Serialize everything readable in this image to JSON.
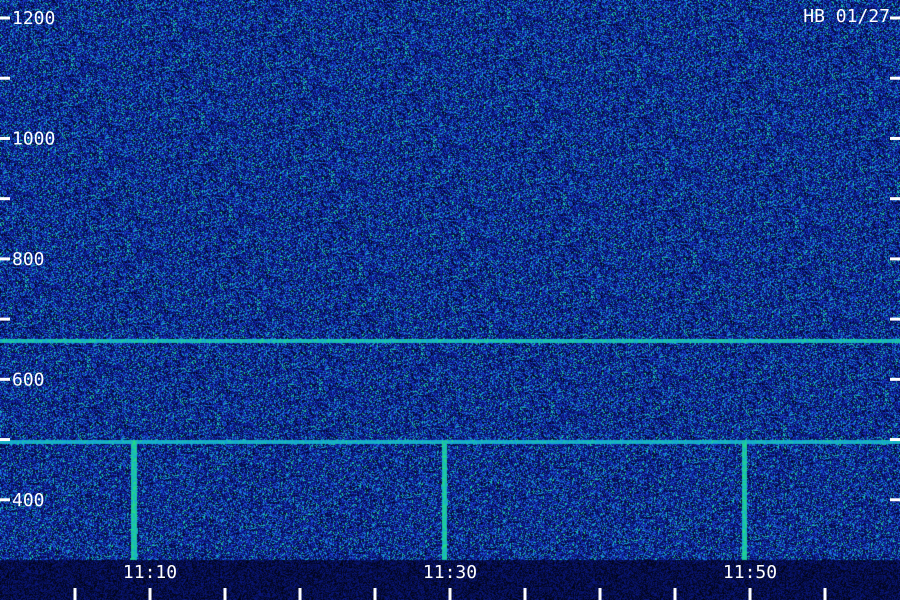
{
  "chart_data": {
    "type": "heatmap",
    "title": "HB 01/27",
    "xlabel": "",
    "ylabel": "",
    "x_ticks": [
      "11:10",
      "11:30",
      "11:50"
    ],
    "x_tick_minutes": [
      10,
      30,
      50
    ],
    "x_range": [
      "11:00",
      "12:00"
    ],
    "y_ticks": [
      1200,
      1000,
      800,
      600,
      400
    ],
    "ylim": [
      300,
      1200
    ],
    "colormap": [
      "#000000",
      "#0b1a8c",
      "#1f3fd6",
      "#13a6d9",
      "#25e07a"
    ],
    "features": [
      {
        "kind": "horizontal-line",
        "y": 664,
        "intensity": 0.9
      },
      {
        "kind": "horizontal-line",
        "y": 497,
        "intensity": 0.55
      },
      {
        "kind": "vertical-burst",
        "x_minute": 8.9,
        "y_from": 300,
        "y_to": 500
      },
      {
        "kind": "vertical-burst",
        "x_minute": 29.6,
        "y_from": 300,
        "y_to": 500
      },
      {
        "kind": "vertical-burst",
        "x_minute": 49.6,
        "y_from": 300,
        "y_to": 500
      }
    ]
  }
}
